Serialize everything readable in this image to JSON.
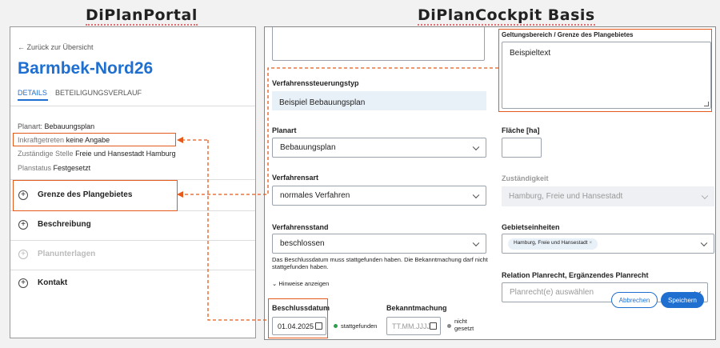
{
  "headings": {
    "portal": "DiPlanPortal",
    "cockpit": "DiPlanCockpit Basis"
  },
  "left": {
    "back_link": "← Zurück zur Übersicht",
    "title": "Barmbek-Nord26",
    "tabs": [
      {
        "label": "DETAILS"
      },
      {
        "label": "BETEILIGUNGSVERLAUF"
      }
    ],
    "props": [
      {
        "key": "Planart:",
        "value": "Bebauungsplan"
      },
      {
        "key": "Inkraftgetreten",
        "value": "keine Angabe"
      },
      {
        "key": "Zuständige Stelle",
        "value": "Freie und Hansestadt Hamburg"
      },
      {
        "key": "Planstatus",
        "value": "Festgesetzt"
      }
    ],
    "sections": [
      {
        "label": "Grenze des Plangebietes"
      },
      {
        "label": "Beschreibung"
      },
      {
        "label": "Planunterlagen"
      },
      {
        "label": "Kontakt"
      }
    ]
  },
  "right": {
    "verfahrenssteuerungstyp": {
      "label": "Verfahrenssteuerungstyp",
      "value": "Beispiel Bebauungsplan"
    },
    "planart": {
      "label": "Planart",
      "value": "Bebauungsplan"
    },
    "verfahrensart": {
      "label": "Verfahrensart",
      "value": "normales Verfahren"
    },
    "verfahrensstand": {
      "label": "Verfahrensstand",
      "value": "beschlossen"
    },
    "hint": "Das Beschlussdatum muss stattgefunden haben. Die Bekanntmachung darf nicht stattgefunden haben.",
    "hint_toggle": "Hinweise anzeigen",
    "beschlussdatum": {
      "label": "Beschlussdatum",
      "value": "01.04.2025",
      "status": "stattgefunden"
    },
    "bekanntmachung": {
      "label": "Bekanntmachung",
      "placeholder": "TT.MM.JJJJ",
      "status_line1": "nicht",
      "status_line2": "gesetzt"
    },
    "geltungsbereich": {
      "label": "Geltungsbereich / Grenze des Plangebietes",
      "value": "Beispieltext"
    },
    "flaeche": {
      "label": "Fläche [ha]"
    },
    "zustaendigkeit": {
      "label": "Zuständigkeit",
      "value": "Hamburg, Freie und Hansestadt"
    },
    "gebietseinheiten": {
      "label": "Gebietseinheiten",
      "chip": "Hamburg, Freie und Hansestadt"
    },
    "relation": {
      "label": "Relation Planrecht, Ergänzendes Planrecht",
      "placeholder": "Planrecht(e) auswählen"
    },
    "buttons": {
      "cancel": "Abbrechen",
      "save": "Speichern"
    }
  },
  "colors": {
    "accent": "#1f6fd1",
    "connector": "#e55a1a",
    "green": "#2e9e4a"
  }
}
